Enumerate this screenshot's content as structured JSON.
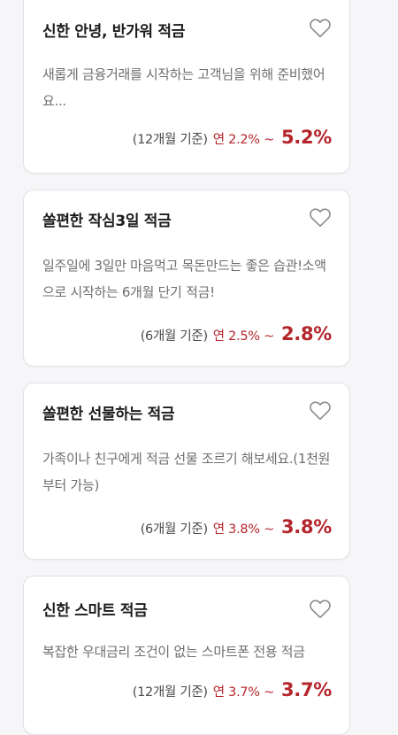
{
  "colors": {
    "accent_red": "#b5262c",
    "title_text": "#1c1c1c",
    "desc_text": "#6e6e72",
    "heart_outline": "#8a8a90"
  },
  "products": [
    {
      "title": "신한 안녕, 반가워 적금",
      "description": "새롭게 금융거래를 시작하는 고객님을 위해 준비했어요...",
      "period": "(12개월 기준)",
      "rate_range": "연 2.2% ~",
      "rate_max": "5.2%",
      "favorite_icon": "heart-outline-icon"
    },
    {
      "title": "쏠편한 작심3일 적금",
      "description": "일주일에 3일만 마음먹고 목돈만드는 좋은 습관!소액으로 시작하는 6개월 단기 적금!",
      "period": "(6개월 기준)",
      "rate_range": "연 2.5% ~",
      "rate_max": "2.8%",
      "favorite_icon": "heart-outline-icon"
    },
    {
      "title": "쏠편한 선물하는 적금",
      "description": "가족이나 친구에게 적금 선물 조르기 해보세요.(1천원부터 가능)",
      "period": "(6개월 기준)",
      "rate_range": "연 3.8% ~",
      "rate_max": "3.8%",
      "favorite_icon": "heart-outline-icon"
    },
    {
      "title": "신한 스마트 적금",
      "description": "복잡한 우대금리 조건이 없는 스마트폰 전용 적금",
      "period": "(12개월 기준)",
      "rate_range": "연 3.7% ~",
      "rate_max": "3.7%",
      "favorite_icon": "heart-outline-icon"
    }
  ]
}
